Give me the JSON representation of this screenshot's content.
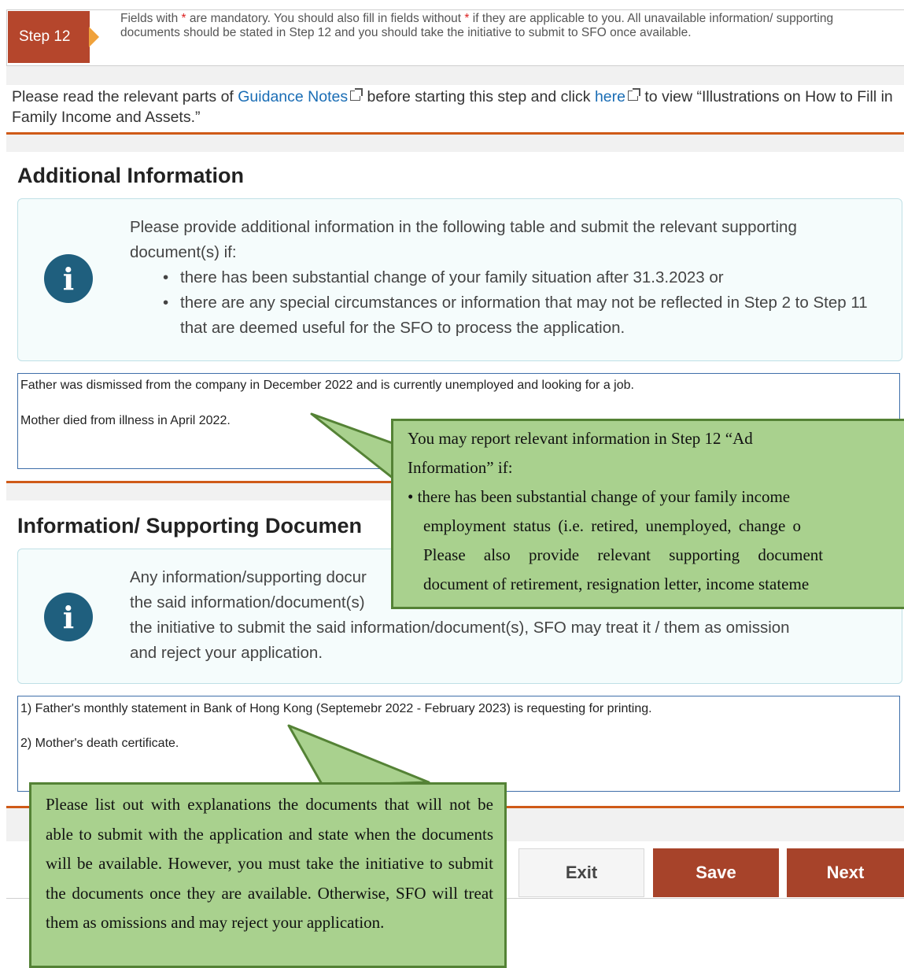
{
  "step_header": {
    "badge": "Step 12",
    "note_before_star1": "Fields with ",
    "star1": "*",
    "note_mid": " are mandatory. You should also fill in fields without ",
    "star2": "*",
    "note_after": " if they are applicable to you. All unavailable information/ supporting documents should be stated in Step 12 and you should take the initiative to submit to SFO once available."
  },
  "intro": {
    "text1": "Please read the relevant parts of ",
    "link1": "Guidance Notes",
    "text2": " before starting this step and click ",
    "link2": "here",
    "text3": " to view “Illustrations on How to Fill in Family Income and Assets.”"
  },
  "additional_info": {
    "title": "Additional Information",
    "info_lead": "Please provide additional information in the following table and submit the relevant supporting document(s) if:",
    "bullets": [
      "there has been substantial change of your family situation after 31.3.2023 or",
      "there are any special circumstances or information that may not be reflected in Step 2 to Step 11 that are deemed useful for the SFO to process the application."
    ],
    "lines": [
      "Father was dismissed from the company in December 2022 and is currently unemployed and looking for a job.",
      "Mother died from illness in April 2022."
    ]
  },
  "supporting_docs": {
    "title": "Information/ Supporting Documen",
    "info_line1": "Any information/supporting docur",
    "info_line2": "the said information/document(s)",
    "info_line3": "the initiative to submit the said information/document(s), SFO may treat it / them as omission",
    "info_line4": "and reject your application.",
    "lines": [
      "1) Father's monthly statement in Bank of Hong Kong (Septemebr 2022 - February 2023) is requesting for printing.",
      "2) Mother's death certificate."
    ]
  },
  "buttons": {
    "exit": "Exit",
    "save": "Save",
    "next": "Next"
  },
  "callout_top": {
    "line1": "You may report relevant information in Step 12 “Ad",
    "line2": "Information” if:",
    "line3": "• there has been substantial change of your family income",
    "line4": "employment status (i.e. retired, unemployed, change o",
    "line5": "Please also provide relevant supporting document",
    "line6": "document of retirement, resignation letter, income stateme"
  },
  "callout_bottom": {
    "text": "Please list out with explanations the documents that will not be able to submit with the application and state when the documents will be available. However, you must take the initiative to submit the documents once they are available. Otherwise, SFO will treat them as omissions and may reject your application."
  },
  "colors": {
    "accent": "#cf5a18",
    "step_badge": "#b5462c",
    "button_primary": "#a7432a",
    "info_icon": "#1f5f7e",
    "callout_fill": "#a9d18e",
    "callout_border": "#548235",
    "link": "#1a6db5"
  },
  "icons": {
    "info": "info-circle-icon",
    "external_link": "external-link-icon",
    "step_arrow": "chevron-right-icon"
  }
}
